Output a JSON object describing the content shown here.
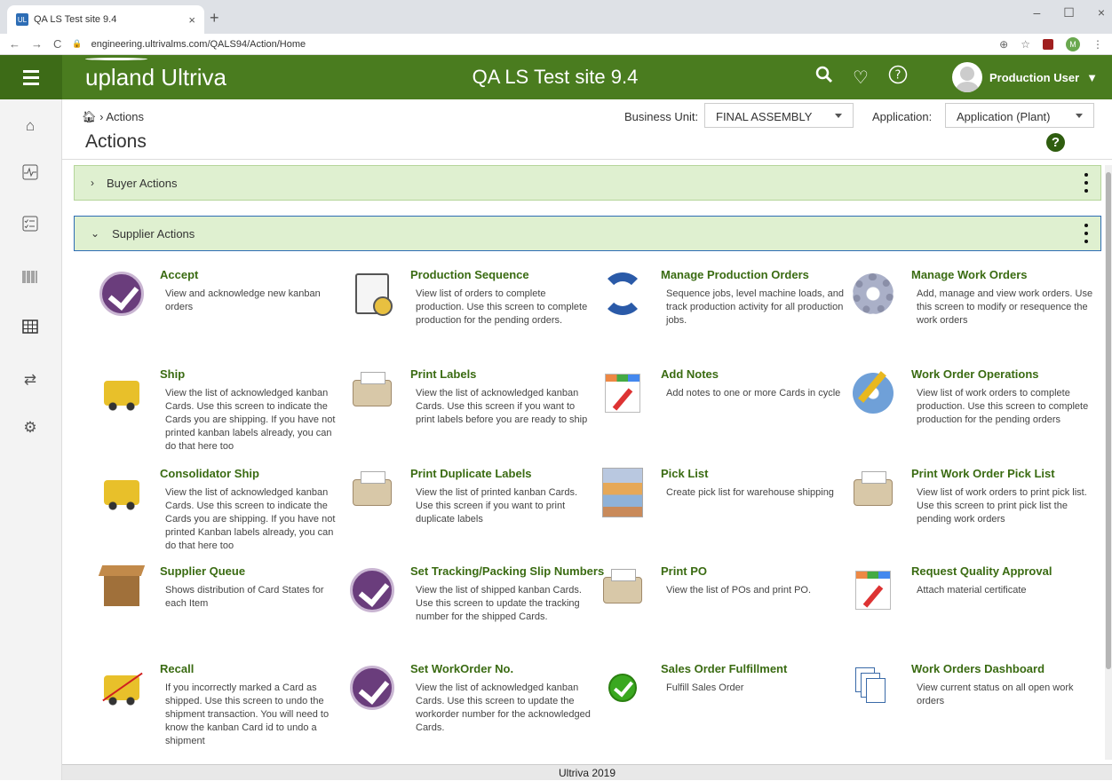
{
  "browser": {
    "tab_title": "QA LS Test site 9.4",
    "tab_favicon": "UL",
    "url": "engineering.ultrivalms.com/QALS94/Action/Home",
    "profile_initial": "M"
  },
  "header": {
    "logo": "upland Ultriva",
    "site_title": "QA LS Test site 9.4",
    "user_name": "Production User"
  },
  "breadcrumb": {
    "label": "Actions"
  },
  "page_title": "Actions",
  "filters": {
    "business_unit_label": "Business Unit:",
    "business_unit_value": "FINAL ASSEMBLY",
    "application_label": "Application:",
    "application_value": "Application (Plant)"
  },
  "panels": {
    "buyer": "Buyer Actions",
    "supplier": "Supplier Actions"
  },
  "actions": [
    {
      "title": "Accept",
      "desc": "View and acknowledge new kanban orders",
      "icon": "purple-check-icon"
    },
    {
      "title": "Production Sequence",
      "desc": "View list of orders to complete production. Use this screen to complete production for the pending orders.",
      "icon": "document-icon"
    },
    {
      "title": "Manage Production Orders",
      "desc": "Sequence jobs, level machine loads, and track production activity for all production jobs.",
      "icon": "refresh-arrows-icon"
    },
    {
      "title": "Manage Work Orders",
      "desc": "Add, manage and view work orders. Use this screen to modify or resequence the work orders",
      "icon": "gears-icon"
    },
    {
      "title": "Ship",
      "desc": "View the list of acknowledged kanban Cards. Use this screen to indicate the Cards you are shipping. If you have not printed kanban labels already, you can do that here too",
      "icon": "truck-icon"
    },
    {
      "title": "Print Labels",
      "desc": "View the list of acknowledged kanban Cards. Use this screen if you want to print labels before you are ready to ship",
      "icon": "printer-icon"
    },
    {
      "title": "Add Notes",
      "desc": "Add notes to one or more Cards in cycle",
      "icon": "notes-icon"
    },
    {
      "title": "Work Order Operations",
      "desc": "View list of work orders to complete production. Use this screen to complete production for the pending orders",
      "icon": "gear-pencil-icon"
    },
    {
      "title": "Consolidator Ship",
      "desc": "View the list of acknowledged kanban Cards. Use this screen to indicate the Cards you are shipping. If you have not printed Kanban labels already, you can do that here too",
      "icon": "truck-icon"
    },
    {
      "title": "Print Duplicate Labels",
      "desc": "View the list of printed kanban Cards. Use this screen if you want to print duplicate labels",
      "icon": "printer-icon"
    },
    {
      "title": "Pick List",
      "desc": "Create pick list for warehouse shipping",
      "icon": "warehouse-icon"
    },
    {
      "title": "Print Work Order Pick List",
      "desc": "View list of work orders to print pick list. Use this screen to print pick list the pending work orders",
      "icon": "printer-icon"
    },
    {
      "title": "Supplier Queue",
      "desc": "Shows distribution of Card States for each Item",
      "icon": "box-icon"
    },
    {
      "title": "Set Tracking/Packing Slip Numbers",
      "desc": "View the list of shipped kanban Cards. Use this screen to update the tracking number for the shipped Cards.",
      "icon": "purple-check-icon"
    },
    {
      "title": "Print PO",
      "desc": "View the list of POs and print PO.",
      "icon": "printer-icon"
    },
    {
      "title": "Request Quality Approval",
      "desc": "Attach material certificate",
      "icon": "notes-icon"
    },
    {
      "title": "Recall",
      "desc": "If you incorrectly marked a Card as shipped. Use this screen to undo the shipment transaction. You will need to know the kanban Card id to undo a shipment",
      "icon": "truck-crossed-icon"
    },
    {
      "title": "Set WorkOrder No.",
      "desc": "View the list of acknowledged kanban Cards. Use this screen to update the workorder number for the acknowledged Cards.",
      "icon": "purple-check-icon"
    },
    {
      "title": "Sales Order Fulfillment",
      "desc": "Fulfill Sales Order",
      "icon": "green-check-icon"
    },
    {
      "title": "Work Orders Dashboard",
      "desc": "View current status on all open work orders",
      "icon": "dashboard-icon"
    }
  ],
  "footer": "Ultriva 2019",
  "colors": {
    "header_green": "#4a7c1f",
    "panel_green": "#dff0d0",
    "link_green": "#3a6b12"
  }
}
